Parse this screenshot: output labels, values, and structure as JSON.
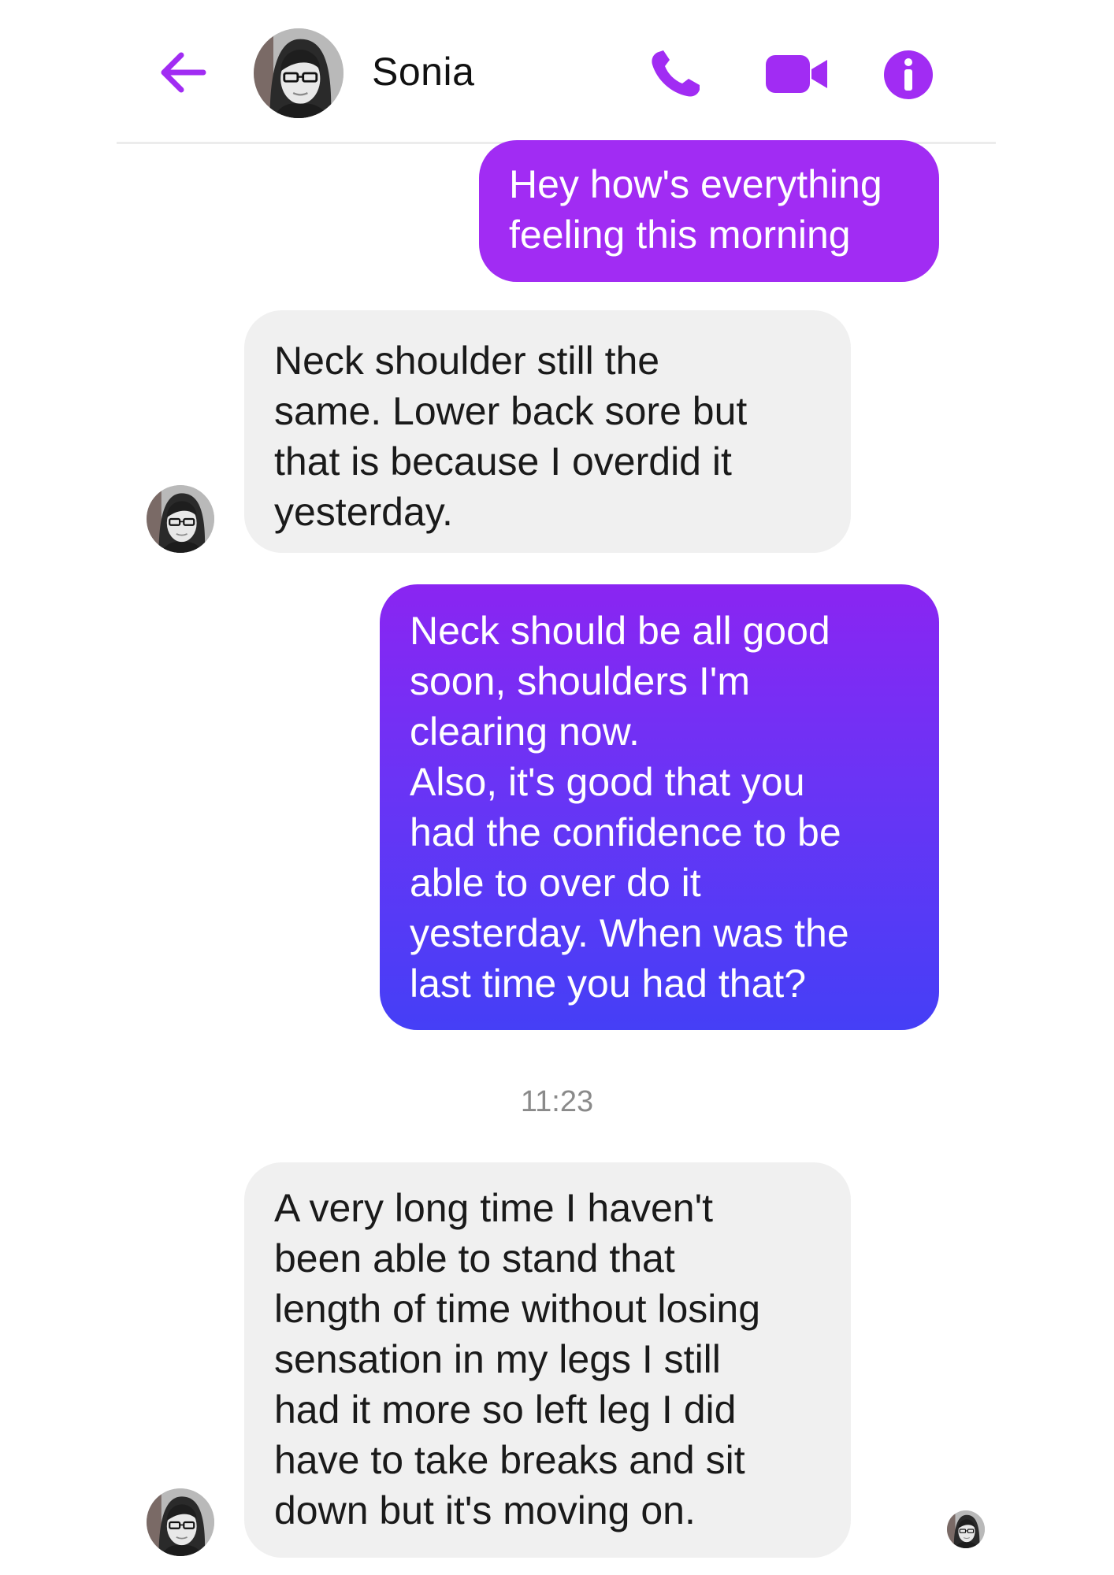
{
  "header": {
    "contact_name": "Sonia",
    "accent_color": "#a12cf3"
  },
  "icons": {
    "back": "back-arrow-icon",
    "call": "phone-icon",
    "video": "video-camera-icon",
    "info": "info-icon"
  },
  "messages": [
    {
      "direction": "outgoing",
      "lines": [
        "Hey how's everything",
        "feeling this morning"
      ]
    },
    {
      "direction": "incoming",
      "lines": [
        "Neck shoulder still the",
        "same. Lower back sore but",
        "that is because I overdid it",
        "yesterday."
      ]
    },
    {
      "direction": "outgoing",
      "lines": [
        "Neck should be all good",
        "soon, shoulders I'm",
        "clearing now.",
        "Also, it's good that you",
        "had the confidence to be",
        "able to over do it",
        "yesterday. When was the",
        "last time you had that?"
      ]
    },
    {
      "direction": "incoming",
      "lines": [
        "A very long time I haven't",
        "been able to stand that",
        "length of time without losing",
        "sensation in my legs I still",
        "had it more so left leg I did",
        "have to take breaks and sit",
        "down but it's moving on."
      ]
    }
  ],
  "timestamp": "11:23"
}
